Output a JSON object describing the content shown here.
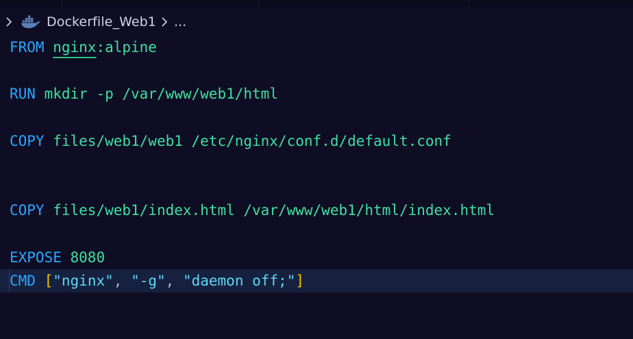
{
  "breadcrumb": {
    "file": "Dockerfile_Web1",
    "ellipsis": "..."
  },
  "editor": {
    "lines": [
      {
        "keyword": "FROM",
        "image": "nginx",
        "tag": ":alpine"
      },
      {
        "keyword": "RUN",
        "args": "mkdir -p /var/www/web1/html"
      },
      {
        "keyword": "COPY",
        "args": "files/web1/web1 /etc/nginx/conf.d/default.conf"
      },
      {
        "keyword": "COPY",
        "args": "files/web1/index.html /var/www/web1/html/index.html"
      },
      {
        "keyword": "EXPOSE",
        "args": "8080"
      },
      {
        "keyword": "CMD",
        "open_bracket": "[",
        "items": [
          "\"nginx\"",
          "\"-g\"",
          "\"daemon off;\""
        ],
        "separator": ",",
        "close_bracket": "]"
      }
    ]
  },
  "colors": {
    "background": "#0f0d24",
    "keyword": "#2aa7ff",
    "argument": "#3fe0a0",
    "string": "#5ed7f5",
    "bracket": "#f2c500",
    "current_line": "#16203f"
  },
  "icons": {
    "breadcrumb_lead": "chevron-right-icon",
    "file_type": "docker-icon",
    "separator": "chevron-right-icon"
  }
}
